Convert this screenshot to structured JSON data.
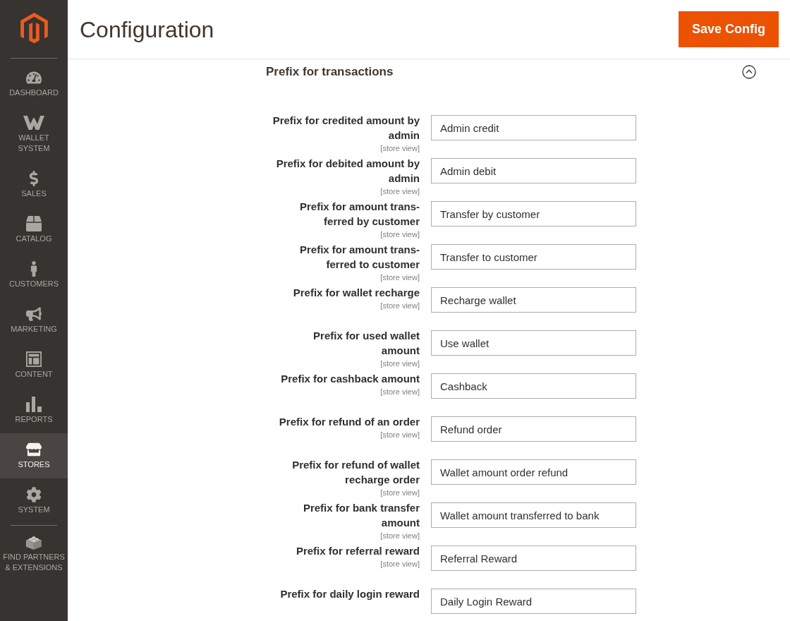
{
  "sidebar": {
    "items": [
      {
        "label": "DASHBOARD",
        "selected": false
      },
      {
        "label": "WALLET\nSYSTEM",
        "selected": false
      },
      {
        "label": "SALES",
        "selected": false
      },
      {
        "label": "CATALOG",
        "selected": false
      },
      {
        "label": "CUSTOMERS",
        "selected": false
      },
      {
        "label": "MARKETING",
        "selected": false
      },
      {
        "label": "CONTENT",
        "selected": false
      },
      {
        "label": "REPORTS",
        "selected": false
      },
      {
        "label": "STORES",
        "selected": true
      },
      {
        "label": "SYSTEM",
        "selected": false
      },
      {
        "label": "FIND PARTNERS\n& EXTENSIONS",
        "selected": false
      }
    ]
  },
  "header": {
    "title": "Configuration",
    "save_button": "Save Config"
  },
  "section": {
    "title": "Prefix for transactions",
    "expanded": true,
    "rows": [
      {
        "label": "Prefix for credited amount by\nadmin",
        "scope": "[store view]",
        "value": "Admin credit"
      },
      {
        "label": "Prefix for debited amount by\nadmin",
        "scope": "[store view]",
        "value": "Admin debit"
      },
      {
        "label": "Prefix for amount trans-\nferred by customer",
        "scope": "[store view]",
        "value": "Transfer by customer"
      },
      {
        "label": "Prefix for amount trans-\nferred to customer",
        "scope": "[store view]",
        "value": "Transfer to customer"
      },
      {
        "label": "Prefix for wallet recharge",
        "scope": "[store view]",
        "value": "Recharge wallet"
      },
      {
        "label": "Prefix for used wallet\namount",
        "scope": "[store view]",
        "value": "Use wallet"
      },
      {
        "label": "Prefix for cashback amount",
        "scope": "[store view]",
        "value": "Cashback"
      },
      {
        "label": "Prefix for refund of an order",
        "scope": "[store view]",
        "value": "Refund order"
      },
      {
        "label": "Prefix for refund of wallet\nrecharge order",
        "scope": "[store view]",
        "value": "Wallet amount order refund"
      },
      {
        "label": "Prefix for bank transfer\namount",
        "scope": "[store view]",
        "value": "Wallet amount transferred to bank"
      },
      {
        "label": "Prefix for referral reward",
        "scope": "[store view]",
        "value": "Referral Reward"
      },
      {
        "label": "Prefix for daily login reward",
        "value": "Daily Login Reward"
      }
    ]
  }
}
